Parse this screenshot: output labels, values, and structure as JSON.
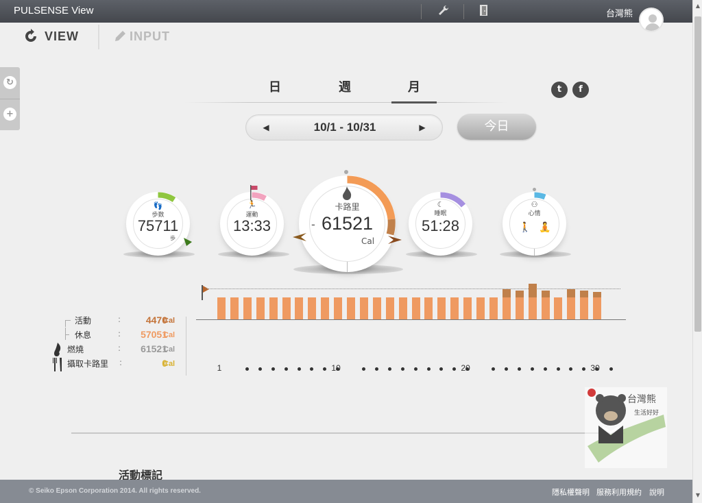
{
  "app": {
    "title": "PULSENSE View",
    "user_name": "台灣熊"
  },
  "toolbar": {
    "settings_icon": "wrench-icon",
    "logout_icon": "door-icon"
  },
  "modes": {
    "view_label": "VIEW",
    "input_label": "INPUT"
  },
  "period_tabs": [
    {
      "label": "日"
    },
    {
      "label": "週"
    },
    {
      "label": "月"
    }
  ],
  "active_period": "月",
  "social": {
    "twitter": "t",
    "facebook": "f"
  },
  "date_nav": {
    "prev": "◀",
    "range": "10/1 - 10/31",
    "next": "▶",
    "today_label": "今日"
  },
  "gauges": {
    "steps": {
      "label": "歩数",
      "value": "75711",
      "unit": "歩",
      "color": "#8fc63f"
    },
    "exercise": {
      "label": "運動",
      "value": "13:33",
      "color": "#f2a3be"
    },
    "calories": {
      "label": "卡路里",
      "value": "61521",
      "sign": "-",
      "unit": "Cal",
      "color": "#f39b56"
    },
    "sleep": {
      "label": "睡眠",
      "value": "51:28",
      "color": "#a58fe0"
    },
    "heart": {
      "label": "心情",
      "color": "#5ab8e4"
    }
  },
  "legend": [
    {
      "label": "活動",
      "value": "4470",
      "unit": "Cal",
      "color": "#c4743a"
    },
    {
      "label": "休息",
      "value": "57051",
      "unit": "Cal",
      "color": "#ef9a61"
    },
    {
      "label": "燃燒",
      "value": "61521",
      "unit": "Cal",
      "color": "#9a9a9a"
    },
    {
      "label": "攝取卡路里",
      "value": "0",
      "unit": "Cal",
      "color": "#d8b233"
    }
  ],
  "chart_data": {
    "type": "bar",
    "x": [
      1,
      2,
      3,
      4,
      5,
      6,
      7,
      8,
      9,
      10,
      11,
      12,
      13,
      14,
      15,
      16,
      17,
      18,
      19,
      20,
      21,
      22,
      23,
      24,
      25,
      26,
      27,
      28,
      29,
      30
    ],
    "series": [
      {
        "values": [
          32,
          32,
          32,
          32,
          32,
          32,
          32,
          32,
          32,
          32,
          32,
          32,
          32,
          32,
          32,
          32,
          32,
          32,
          32,
          32,
          32,
          32,
          32,
          32,
          32,
          32,
          32,
          32,
          32,
          32
        ]
      },
      {
        "values": [
          0,
          0,
          0,
          0,
          0,
          0,
          0,
          0,
          0,
          0,
          0,
          0,
          0,
          0,
          0,
          0,
          0,
          0,
          0,
          0,
          0,
          0,
          12,
          10,
          20,
          10,
          0,
          12,
          10,
          8
        ]
      }
    ],
    "target_line": 45,
    "tick_labels": [
      "1",
      "10",
      "20",
      "30"
    ]
  },
  "section": {
    "title": "活動標記"
  },
  "footer": {
    "copyright": "© Seiko Epson Corporation 2014. All rights reserved.",
    "links": [
      "隱私權聲明",
      "服務利用規約",
      "說明"
    ]
  }
}
